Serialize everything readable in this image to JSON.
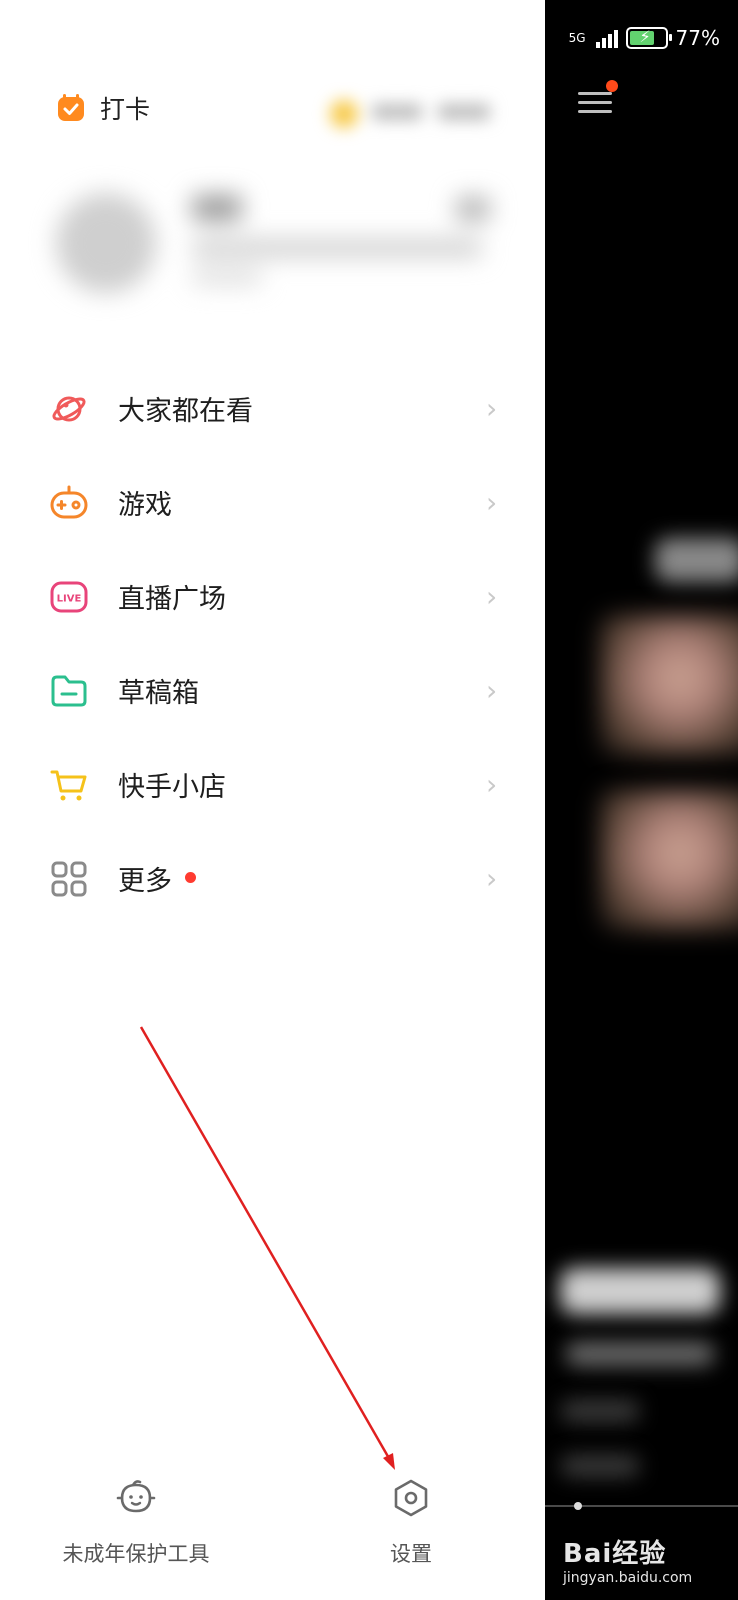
{
  "status_bar": {
    "network": "5G",
    "battery": "77%"
  },
  "drawer": {
    "checkin_label": "打卡",
    "menu": [
      {
        "label": "大家都在看",
        "icon": "planet-icon",
        "color": "#f05a5a"
      },
      {
        "label": "游戏",
        "icon": "gamepad-icon",
        "color": "#f5862a"
      },
      {
        "label": "直播广场",
        "icon": "live-icon",
        "color": "#e8447a"
      },
      {
        "label": "草稿箱",
        "icon": "folder-icon",
        "color": "#2bbf8e"
      },
      {
        "label": "快手小店",
        "icon": "cart-icon",
        "color": "#f5c21a"
      },
      {
        "label": "更多",
        "icon": "grid-icon",
        "color": "#8a8a8a",
        "badge": true
      }
    ],
    "bottom": {
      "minor_protection_label": "未成年保护工具",
      "settings_label": "设置"
    }
  },
  "watermark": {
    "main": "Bai经验",
    "url": "jingyan.baidu.com"
  },
  "colors": {
    "accent": "#ff8a1f",
    "annotation_arrow": "#e02020"
  }
}
